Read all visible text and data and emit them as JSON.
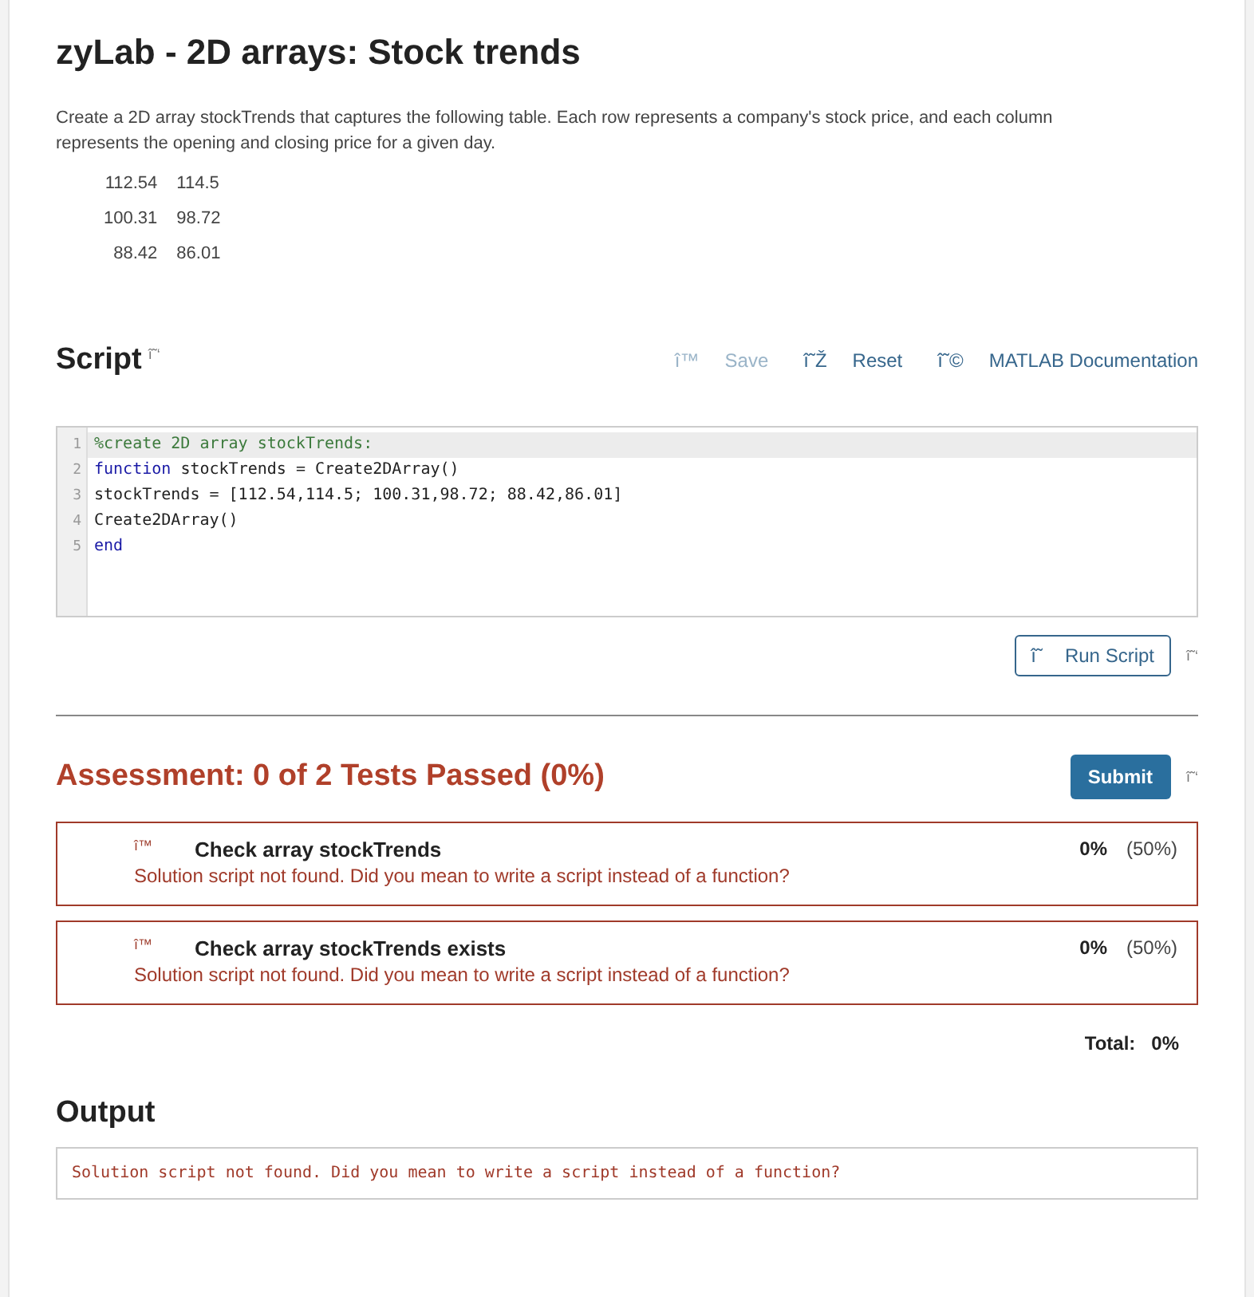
{
  "title": "zyLab - 2D arrays: Stock trends",
  "description": "Create a 2D array stockTrends that captures the following table. Each row represents a company's stock price, and each column represents the opening and closing price for a given day.",
  "table": {
    "rows": [
      [
        "112.54",
        "114.5"
      ],
      [
        "100.31",
        "98.72"
      ],
      [
        "88.42",
        "86.01"
      ]
    ]
  },
  "script": {
    "heading": "Script",
    "heading_icon": "î˜‘",
    "toolbar": [
      {
        "icon": "î™",
        "label": "Save",
        "disabled": true
      },
      {
        "icon": "î˜Ž",
        "label": "Reset",
        "disabled": false
      },
      {
        "icon": "î˜©",
        "label": "MATLAB Documentation",
        "disabled": false
      }
    ],
    "code": [
      {
        "number": "1",
        "active": true,
        "tokens": [
          {
            "kind": "comment",
            "text": "%create 2D array stockTrends:"
          }
        ]
      },
      {
        "number": "2",
        "active": false,
        "tokens": [
          {
            "kind": "keyword",
            "text": "function"
          },
          {
            "kind": "plain",
            "text": " stockTrends = Create2DArray()"
          }
        ]
      },
      {
        "number": "3",
        "active": false,
        "tokens": [
          {
            "kind": "plain",
            "text": "stockTrends = [112.54,114.5; 100.31,98.72; 88.42,86.01]"
          }
        ]
      },
      {
        "number": "4",
        "active": false,
        "tokens": [
          {
            "kind": "plain",
            "text": "Create2DArray()"
          }
        ]
      },
      {
        "number": "5",
        "active": false,
        "tokens": [
          {
            "kind": "keyword",
            "text": "end"
          }
        ]
      }
    ],
    "run_button": {
      "icon": "î˜",
      "label": "Run Script"
    },
    "run_help_icon": "î˜‘"
  },
  "assessment": {
    "heading": "Assessment: 0 of 2 Tests Passed (0%)",
    "submit": "Submit",
    "submit_help_icon": "î˜‘",
    "tests": [
      {
        "icon": "î™",
        "name": "Check array stockTrends",
        "message": "Solution script not found. Did you mean to write a script instead of a function?",
        "score": "0%",
        "weight": "(50%)",
        "passed": false
      },
      {
        "icon": "î™",
        "name": "Check array stockTrends exists",
        "message": "Solution script not found. Did you mean to write a script instead of a function?",
        "score": "0%",
        "weight": "(50%)",
        "passed": false
      }
    ],
    "total_label": "Total:",
    "total_value": "0%"
  },
  "output": {
    "heading": "Output",
    "text": "Solution script not found. Did you mean to write a script instead of a function?"
  }
}
